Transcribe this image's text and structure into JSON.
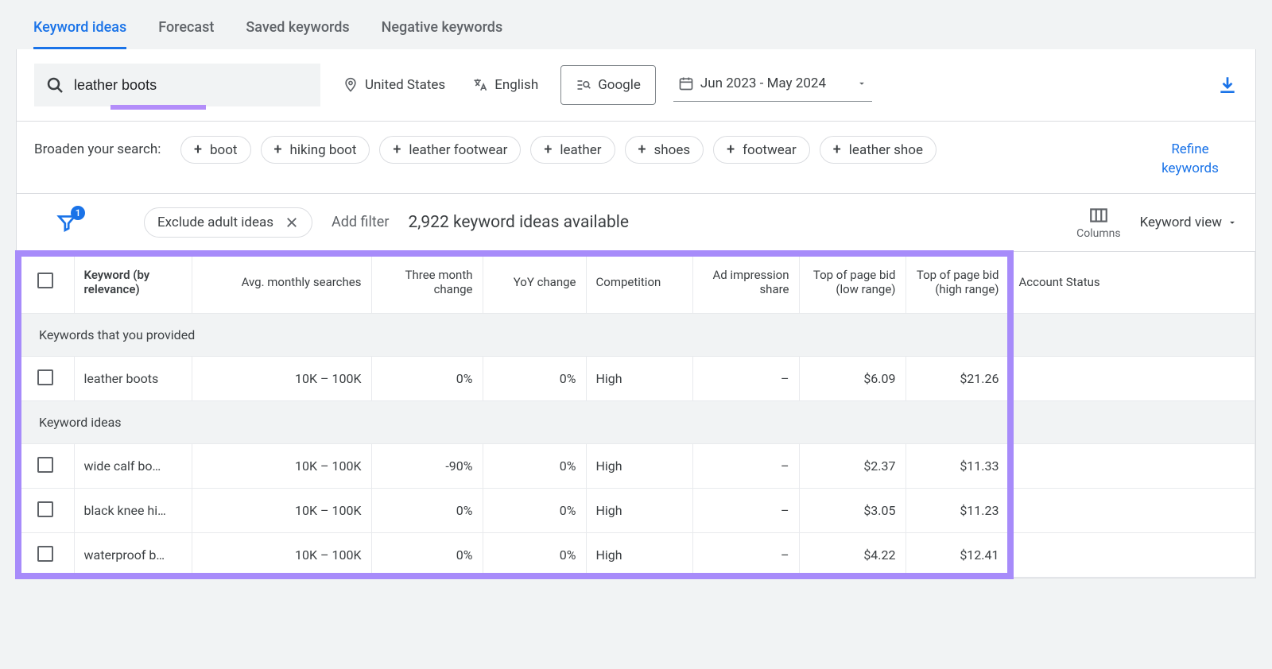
{
  "tabs": {
    "keyword_ideas": "Keyword ideas",
    "forecast": "Forecast",
    "saved_keywords": "Saved keywords",
    "negative_keywords": "Negative keywords"
  },
  "searchbar": {
    "query": "leather boots",
    "location": "United States",
    "language": "English",
    "network": "Google",
    "date_range": "Jun 2023 - May 2024"
  },
  "broaden": {
    "label": "Broaden your search:",
    "chips": [
      "boot",
      "hiking boot",
      "leather footwear",
      "leather",
      "shoes",
      "footwear",
      "leather shoe"
    ],
    "refine": "Refine keywords"
  },
  "filters": {
    "badge": "1",
    "exclude": "Exclude adult ideas",
    "add_filter": "Add filter",
    "count_text": "2,922 keyword ideas available",
    "columns_label": "Columns",
    "view_label": "Keyword view"
  },
  "table": {
    "headers": {
      "keyword": "Keyword (by relevance)",
      "avg": "Avg. monthly searches",
      "three_month": "Three month change",
      "yoy": "YoY change",
      "competition": "Competition",
      "ad_impression": "Ad impression share",
      "bid_low": "Top of page bid (low range)",
      "bid_high": "Top of page bid (high range)",
      "account_status": "Account Status"
    },
    "section_provided": "Keywords that you provided",
    "section_ideas": "Keyword ideas",
    "rows_provided": [
      {
        "keyword": "leather boots",
        "avg": "10K – 100K",
        "three_month": "0%",
        "yoy": "0%",
        "competition": "High",
        "ad_impression": "–",
        "bid_low": "$6.09",
        "bid_high": "$21.26"
      }
    ],
    "rows_ideas": [
      {
        "keyword": "wide calf bo…",
        "avg": "10K – 100K",
        "three_month": "-90%",
        "yoy": "0%",
        "competition": "High",
        "ad_impression": "–",
        "bid_low": "$2.37",
        "bid_high": "$11.33"
      },
      {
        "keyword": "black knee hi…",
        "avg": "10K – 100K",
        "three_month": "0%",
        "yoy": "0%",
        "competition": "High",
        "ad_impression": "–",
        "bid_low": "$3.05",
        "bid_high": "$11.23"
      },
      {
        "keyword": "waterproof b…",
        "avg": "10K – 100K",
        "three_month": "0%",
        "yoy": "0%",
        "competition": "High",
        "ad_impression": "–",
        "bid_low": "$4.22",
        "bid_high": "$12.41"
      }
    ]
  }
}
